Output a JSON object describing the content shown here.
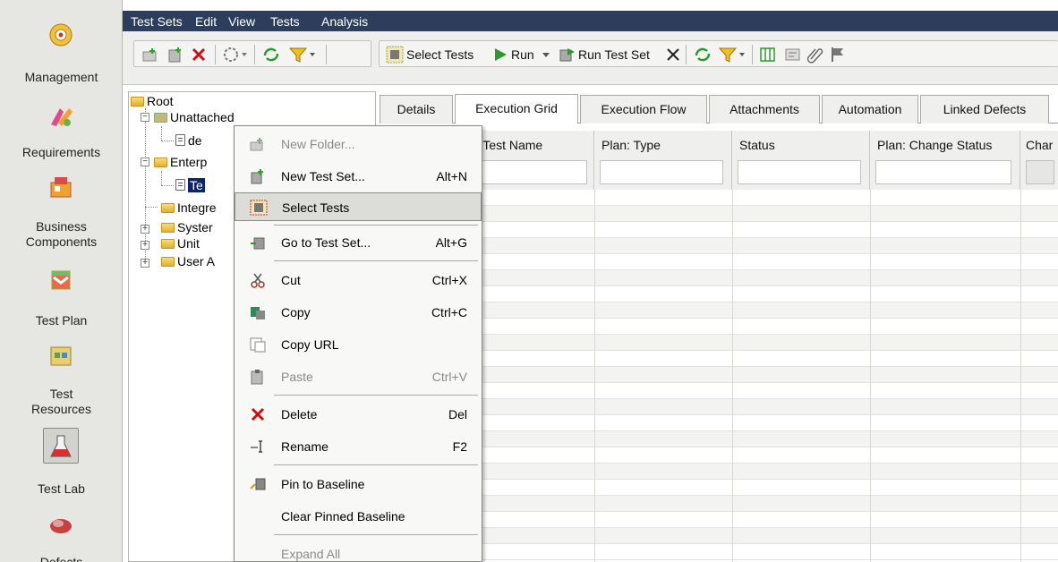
{
  "sidebar": {
    "items": [
      {
        "label": "Management",
        "icon": "management-icon"
      },
      {
        "label": "Requirements",
        "icon": "requirements-icon"
      },
      {
        "label": "Business\nComponents",
        "icon": "business-components-icon"
      },
      {
        "label": "Test Plan",
        "icon": "test-plan-icon"
      },
      {
        "label": "Test\nResources",
        "icon": "test-resources-icon"
      },
      {
        "label": "Test Lab",
        "icon": "test-lab-icon"
      },
      {
        "label": "Defects",
        "icon": "defects-icon"
      }
    ]
  },
  "menubar": {
    "items": [
      "Test Sets",
      "Edit",
      "View",
      "Tests",
      "Analysis"
    ]
  },
  "toolbar": {
    "select_tests": "Select Tests",
    "run": "Run",
    "run_test_set": "Run Test Set"
  },
  "tree": {
    "root": "Root",
    "unattached": "Unattached",
    "de": "de",
    "enterprise": "Enterp",
    "te": "Te",
    "integration": "Integre",
    "system": "Syster",
    "unit": "Unit",
    "user": "User A"
  },
  "tabs": [
    "Details",
    "Execution Grid",
    "Execution Flow",
    "Attachments",
    "Automation",
    "Linked Defects"
  ],
  "grid": {
    "columns": [
      "n: Test Name",
      "Plan: Type",
      "Status",
      "Plan: Change Status",
      "Char"
    ]
  },
  "context_menu": {
    "items": [
      {
        "label": "New Folder...",
        "shortcut": ""
      },
      {
        "label": "New Test Set...",
        "shortcut": "Alt+N"
      },
      {
        "label": "Select Tests",
        "shortcut": ""
      },
      {
        "label": "Go to Test Set...",
        "shortcut": "Alt+G"
      },
      {
        "label": "Cut",
        "shortcut": "Ctrl+X"
      },
      {
        "label": "Copy",
        "shortcut": "Ctrl+C"
      },
      {
        "label": "Copy URL",
        "shortcut": ""
      },
      {
        "label": "Paste",
        "shortcut": "Ctrl+V"
      },
      {
        "label": "Delete",
        "shortcut": "Del"
      },
      {
        "label": "Rename",
        "shortcut": "F2"
      },
      {
        "label": "Pin to Baseline",
        "shortcut": ""
      },
      {
        "label": "Clear Pinned Baseline",
        "shortcut": ""
      },
      {
        "label": "Expand All",
        "shortcut": ""
      }
    ]
  },
  "colors": {
    "menubar": "#2c3e5c",
    "sidebar": "#e6e6e2",
    "highlight": "#dcdcd8",
    "delete_red": "#cc1010",
    "run_green": "#2a9a2a"
  }
}
